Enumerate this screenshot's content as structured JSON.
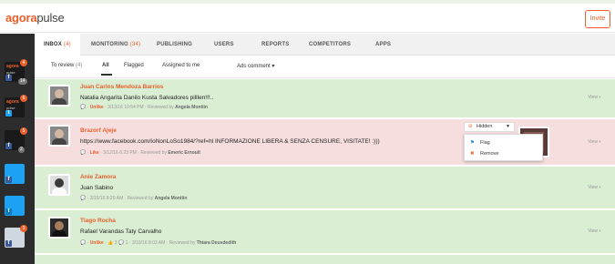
{
  "brand": {
    "part1": "agora",
    "part2": "pulse"
  },
  "invite_label": "Invite",
  "nav": {
    "tabs": [
      {
        "label": "INBOX",
        "count": "(4)"
      },
      {
        "label": "MONITORING",
        "count": "(34)"
      },
      {
        "label": "PUBLISHING"
      },
      {
        "label": "USERS"
      },
      {
        "label": "REPORTS"
      },
      {
        "label": "COMPETITORS"
      },
      {
        "label": "APPS"
      }
    ]
  },
  "subtabs": {
    "to_review": "To review",
    "to_review_count": "(4)",
    "all": "All",
    "flagged": "Flagged",
    "assigned": "Assigned to me",
    "ads": "Ads comment"
  },
  "profiles": [
    {
      "text": "agora",
      "sub": "pulse",
      "network": "f",
      "badge": "4",
      "count": "14"
    },
    {
      "text": "agora",
      "sub": "pulse",
      "network": "t",
      "badge": "6"
    },
    {
      "text": "",
      "sub": "",
      "network": "f",
      "badge": "5",
      "count": "2"
    },
    {
      "text": "",
      "sub": "",
      "network": "f"
    },
    {
      "text": "",
      "sub": "",
      "network": "t"
    },
    {
      "text": "",
      "sub": "",
      "network": "f",
      "badge": "3"
    }
  ],
  "items": [
    {
      "name": "Juan Carlos Mendoza Barrios",
      "message": "Natalia Angarita Danilo Kusta Salvadores pilllen!!!..",
      "action": "Unlike",
      "date": "3/13/16 10:54 PM",
      "reviewed": "Reviewed by",
      "reviewer": "Angela Montiin",
      "view": "View"
    },
    {
      "name": "Brazorf Ajeje",
      "message": "https://www.facebook.com/IoNonLoSo1984/?ref=hl INFORMAZIONE LIBERA & SENZA CENSURE, VISITATE! :)))",
      "action": "Like",
      "date": "3/12/16 6:23 PM",
      "reviewed": "Reviewed by",
      "reviewer": "Emeric Ernoult",
      "view": "View"
    },
    {
      "name": "Anie Zamora",
      "message": "Juan Sabino",
      "action": "",
      "date": "3/10/16 8:20 AM",
      "reviewed": "Reviewed by",
      "reviewer": "Angela Montiin",
      "view": "View"
    },
    {
      "name": "Tiago Rocha",
      "message": "Rafael Varandas Taty Carvalho",
      "action": "Unlike",
      "likes": "3",
      "comments": "1",
      "date": "3/10/16 8:03 AM",
      "reviewed": "Reviewed by",
      "reviewer": "Thiara Deusdedith",
      "view": "View"
    }
  ],
  "hidden_menu": {
    "button": "Hidden",
    "options": [
      {
        "icon": "flag-icon",
        "label": "Flag"
      },
      {
        "icon": "remove-icon",
        "label": "Remove"
      }
    ]
  },
  "colors": {
    "accent": "#e8602c",
    "green_row": "#d9eed3",
    "red_row": "#f6dede"
  }
}
